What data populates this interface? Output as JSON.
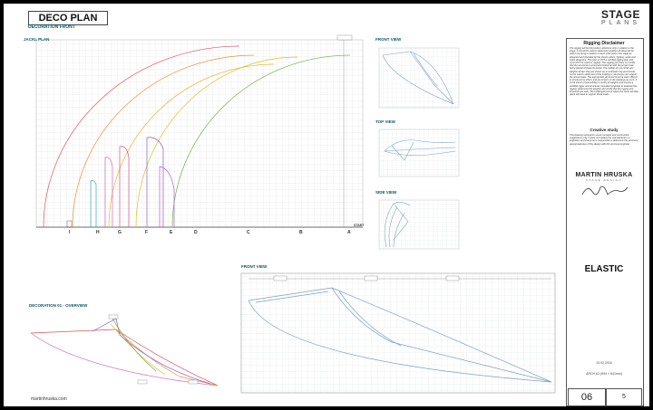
{
  "title": "DECO PLAN",
  "subtitle": "DECORATION FRONT",
  "website": "martinhruska.com",
  "panels": {
    "jack_plan": "JACKL PLAN",
    "front_view_small": "FRONT VIEW",
    "top_view": "TOP VIEW",
    "side_view": "SIDE VIEW",
    "front_view_large": "FRONT VIEW",
    "overview": "DECORATION 01 - OVERVIEW"
  },
  "axis_letters": [
    "I",
    "H",
    "G",
    "F",
    "E",
    "D",
    "C",
    "B",
    "A"
  ],
  "start_label": "START",
  "brand": {
    "line1": "STAGE",
    "line2": "PLANS"
  },
  "disclaimer": {
    "title": "Rigging Disclaimer",
    "text": "The rigging will be full position reference only in relation to the stage. It should be used to determine whether all ideas will be able to be hung in relation to each other and to the stage as designed and intended by the show's artists, lighting, audio and video designers. This plan is NOT a certified rigging plan and must NOT be used for rigging. This rigging plot does not certify that the structural is sound and bolted up with the proper load being placed at these fix points. The builder do not certify any weights shown they are shown as an estimate only and should not be used to determine if the building or structures can support the actual loads. The appropriate structural must be were offered to structural by others and are shown on the drawings as such. It is the show's responsibility to certify all weights and employ a certified rigger and structural consultant engineer to evaluate the rigging, determine the weights and certify that the rigging and structural are safe. The building/structure where the show will take place will need to support these loads."
  },
  "creative": {
    "title": "Creative study",
    "text": "This drawing represents visual concepts and construction suggestions only. It does not replace the manufacturers or engineers and everyone is responsible to determine the structural appropriateness of this design with full structural engineer."
  },
  "designer": {
    "name": "MARTIN HRUSKA",
    "tagline": "STAGE DESIGN"
  },
  "project": "ELASTIC",
  "date": "23.02.2016",
  "format": "ARCH A1 (594 × 841mm)",
  "sheet_number": "06",
  "sheet_total": "5",
  "colors": {
    "grid": "#c9d1d1",
    "line": "#7fa0c0",
    "arc_red": "#d9555a",
    "arc_orange": "#e8913a",
    "arc_yellow": "#d9c12a",
    "arc_green": "#6fb04a",
    "arc_violet": "#8a5cc4",
    "arc_pink": "#d46fb5",
    "arc_teal": "#3fa8a8"
  }
}
